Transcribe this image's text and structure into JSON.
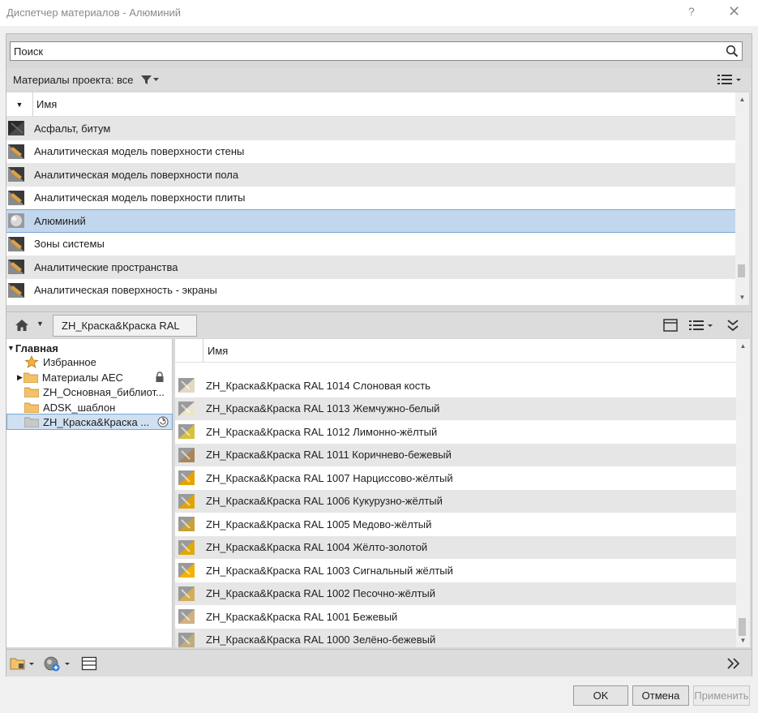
{
  "window": {
    "title": "Диспетчер материалов - Алюминий",
    "help_glyph": "?",
    "close_glyph": "✕"
  },
  "search": {
    "placeholder": "Поиск"
  },
  "project": {
    "filter_label": "Материалы проекта: все",
    "column_name": "Имя",
    "items": [
      {
        "label": "Асфальт, битум",
        "swatch": "dark"
      },
      {
        "label": "Аналитическая модель поверхности стены",
        "swatch": "gray"
      },
      {
        "label": "Аналитическая модель поверхности пола",
        "swatch": "gray"
      },
      {
        "label": "Аналитическая модель поверхности плиты",
        "swatch": "gray"
      },
      {
        "label": "Алюминий",
        "swatch": "metal",
        "selected": true
      },
      {
        "label": "Зоны системы",
        "swatch": "gray"
      },
      {
        "label": "Аналитические пространства",
        "swatch": "gray"
      },
      {
        "label": "Аналитическая поверхность - экраны",
        "swatch": "gray"
      }
    ]
  },
  "library": {
    "breadcrumb": "ZH_Краска&Краска RAL",
    "column_name": "Имя",
    "tree": [
      {
        "label": "Главная"
      },
      {
        "label": "Избранное"
      },
      {
        "label": "Материалы AEC"
      },
      {
        "label": "ZH_Основная_библиот..."
      },
      {
        "label": "ADSK_шаблон"
      },
      {
        "label": "ZH_Краска&Краска ..."
      }
    ],
    "items": [
      {
        "label": "ZH_Краска&Краска RAL 1014 Слоновая кость",
        "color": "#e3d9c1"
      },
      {
        "label": "ZH_Краска&Краска RAL 1013 Жемчужно-белый",
        "color": "#eae6ca"
      },
      {
        "label": "ZH_Краска&Краска RAL 1012 Лимонно-жёлтый",
        "color": "#d8c03a"
      },
      {
        "label": "ZH_Краска&Краска RAL 1011 Коричнево-бежевый",
        "color": "#a98558"
      },
      {
        "label": "ZH_Краска&Краска RAL 1007 Нарциссово-жёлтый",
        "color": "#e5a300"
      },
      {
        "label": "ZH_Краска&Краска RAL 1006 Кукурузно-жёлтый",
        "color": "#e2a300"
      },
      {
        "label": "ZH_Краска&Краска RAL 1005 Медово-жёлтый",
        "color": "#cba135"
      },
      {
        "label": "ZH_Краска&Краска RAL 1004 Жёлто-золотой",
        "color": "#e0a909"
      },
      {
        "label": "ZH_Краска&Краска RAL 1003 Сигнальный жёлтый",
        "color": "#f3b100"
      },
      {
        "label": "ZH_Краска&Краска RAL 1002 Песочно-жёлтый",
        "color": "#d2ad5a"
      },
      {
        "label": "ZH_Краска&Краска RAL 1001 Бежевый",
        "color": "#d0b084"
      },
      {
        "label": "ZH_Краска&Краска RAL 1000 Зелёно-бежевый",
        "color": "#bdad7d"
      }
    ]
  },
  "buttons": {
    "ok": "OK",
    "cancel": "Отмена",
    "apply": "Применить"
  },
  "colors": {
    "selection": "#c2d7ed",
    "selection_border": "#7aa6d6"
  }
}
